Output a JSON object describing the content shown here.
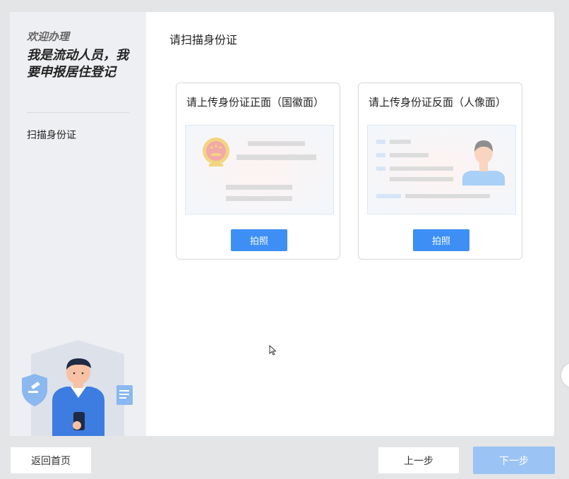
{
  "sidebar": {
    "welcome": "欢迎办理",
    "headline": "我是流动人员，我要申报居住登记",
    "steps": [
      "扫描身份证"
    ]
  },
  "main": {
    "title": "请扫描身份证",
    "cards": [
      {
        "title": "请上传身份证正面（国徽面）",
        "button": "拍照"
      },
      {
        "title": "请上传身份证反面（人像面）",
        "button": "拍照"
      }
    ]
  },
  "footer": {
    "home_label": "返回首页",
    "prev_label": "上一步",
    "next_label": "下一步"
  },
  "colors": {
    "accent": "#3d8ff5",
    "accent_disabled": "#9bc4f4",
    "sidebar_bg": "#eeeff2",
    "page_bg": "#e4e5e7"
  }
}
